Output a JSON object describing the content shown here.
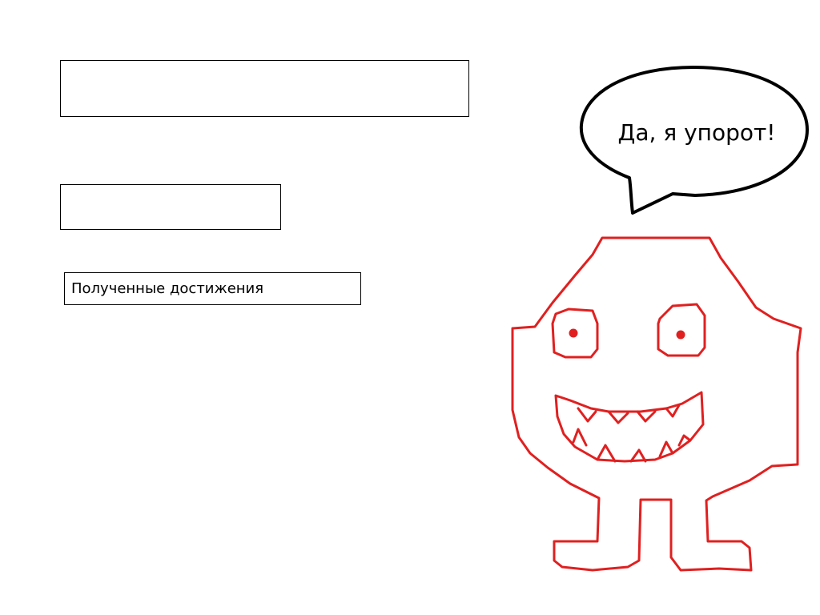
{
  "fields": {
    "name_value": "",
    "level_value": "",
    "achievements_label": "Полученные достижения"
  },
  "speech_bubble": {
    "text": "Да, я упорот!"
  },
  "colors": {
    "outline": "#000000",
    "monster": "#e02020",
    "background": "#ffffff"
  },
  "icons": {
    "character": "red-monster-doodle",
    "bubble": "speech-bubble"
  }
}
